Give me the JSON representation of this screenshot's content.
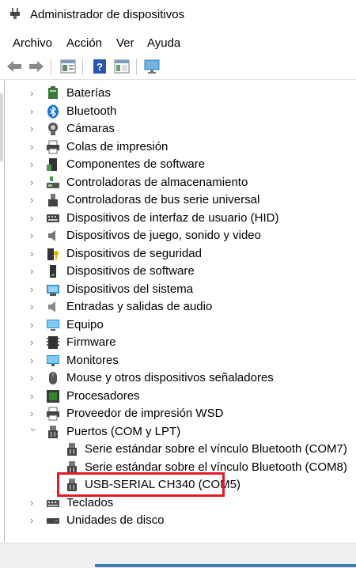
{
  "window": {
    "title": "Administrador de dispositivos"
  },
  "menu": [
    "Archivo",
    "Acción",
    "Ver",
    "Ayuda"
  ],
  "toolbar": {
    "icons": [
      "back-arrow-icon",
      "forward-arrow-icon",
      "properties-icon",
      "help-icon",
      "panel-icon",
      "monitor-icon"
    ]
  },
  "tree": {
    "items": [
      {
        "label": "Baterías",
        "icon": "battery-icon",
        "expanded": false
      },
      {
        "label": "Bluetooth",
        "icon": "bluetooth-icon",
        "expanded": false
      },
      {
        "label": "Cámaras",
        "icon": "camera-icon",
        "expanded": false
      },
      {
        "label": "Colas de impresión",
        "icon": "printer-queue-icon",
        "expanded": false
      },
      {
        "label": "Componentes de software",
        "icon": "software-component-icon",
        "expanded": false
      },
      {
        "label": "Controladoras de almacenamiento",
        "icon": "storage-controller-icon",
        "expanded": false
      },
      {
        "label": "Controladoras de bus serie universal",
        "icon": "usb-controller-icon",
        "expanded": false
      },
      {
        "label": "Dispositivos de interfaz de usuario (HID)",
        "icon": "hid-icon",
        "expanded": false
      },
      {
        "label": "Dispositivos de juego, sonido y video",
        "icon": "speaker-icon",
        "expanded": false
      },
      {
        "label": "Dispositivos de seguridad",
        "icon": "security-device-icon",
        "expanded": false
      },
      {
        "label": "Dispositivos de software",
        "icon": "software-device-icon",
        "expanded": false
      },
      {
        "label": "Dispositivos del sistema",
        "icon": "system-device-icon",
        "expanded": false
      },
      {
        "label": "Entradas y salidas de audio",
        "icon": "audio-io-icon",
        "expanded": false
      },
      {
        "label": "Equipo",
        "icon": "computer-icon",
        "expanded": false
      },
      {
        "label": "Firmware",
        "icon": "firmware-icon",
        "expanded": false
      },
      {
        "label": "Monitores",
        "icon": "monitor-icon",
        "expanded": false
      },
      {
        "label": "Mouse y otros dispositivos señaladores",
        "icon": "mouse-icon",
        "expanded": false
      },
      {
        "label": "Procesadores",
        "icon": "processor-icon",
        "expanded": false
      },
      {
        "label": "Proveedor de impresión WSD",
        "icon": "wsd-printer-icon",
        "expanded": false
      },
      {
        "label": "Puertos (COM y LPT)",
        "icon": "port-icon",
        "expanded": true
      },
      {
        "label": "Serie estándar sobre el vínculo Bluetooth (COM7)",
        "icon": "port-icon",
        "child": true
      },
      {
        "label": "Serie estándar sobre el vínculo Bluetooth (COM8)",
        "icon": "port-icon",
        "child": true
      },
      {
        "label": "USB-SERIAL CH340 (COM5)",
        "icon": "port-icon",
        "child": true,
        "highlighted": true
      },
      {
        "label": "Teclados",
        "icon": "keyboard-icon",
        "expanded": false
      },
      {
        "label": "Unidades de disco",
        "icon": "disk-drive-icon",
        "expanded": false
      }
    ]
  },
  "colors": {
    "highlight": "#e01b24",
    "accent": "#3c7fb1"
  }
}
